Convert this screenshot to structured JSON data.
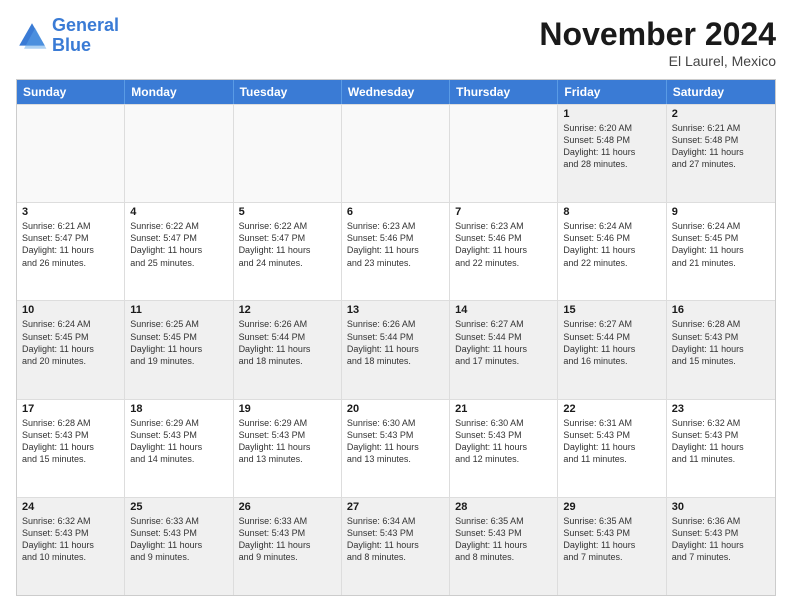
{
  "logo": {
    "line1": "General",
    "line2": "Blue"
  },
  "title": "November 2024",
  "location": "El Laurel, Mexico",
  "days": [
    "Sunday",
    "Monday",
    "Tuesday",
    "Wednesday",
    "Thursday",
    "Friday",
    "Saturday"
  ],
  "rows": [
    [
      {
        "day": "",
        "info": ""
      },
      {
        "day": "",
        "info": ""
      },
      {
        "day": "",
        "info": ""
      },
      {
        "day": "",
        "info": ""
      },
      {
        "day": "",
        "info": ""
      },
      {
        "day": "1",
        "info": "Sunrise: 6:20 AM\nSunset: 5:48 PM\nDaylight: 11 hours\nand 28 minutes."
      },
      {
        "day": "2",
        "info": "Sunrise: 6:21 AM\nSunset: 5:48 PM\nDaylight: 11 hours\nand 27 minutes."
      }
    ],
    [
      {
        "day": "3",
        "info": "Sunrise: 6:21 AM\nSunset: 5:47 PM\nDaylight: 11 hours\nand 26 minutes."
      },
      {
        "day": "4",
        "info": "Sunrise: 6:22 AM\nSunset: 5:47 PM\nDaylight: 11 hours\nand 25 minutes."
      },
      {
        "day": "5",
        "info": "Sunrise: 6:22 AM\nSunset: 5:47 PM\nDaylight: 11 hours\nand 24 minutes."
      },
      {
        "day": "6",
        "info": "Sunrise: 6:23 AM\nSunset: 5:46 PM\nDaylight: 11 hours\nand 23 minutes."
      },
      {
        "day": "7",
        "info": "Sunrise: 6:23 AM\nSunset: 5:46 PM\nDaylight: 11 hours\nand 22 minutes."
      },
      {
        "day": "8",
        "info": "Sunrise: 6:24 AM\nSunset: 5:46 PM\nDaylight: 11 hours\nand 22 minutes."
      },
      {
        "day": "9",
        "info": "Sunrise: 6:24 AM\nSunset: 5:45 PM\nDaylight: 11 hours\nand 21 minutes."
      }
    ],
    [
      {
        "day": "10",
        "info": "Sunrise: 6:24 AM\nSunset: 5:45 PM\nDaylight: 11 hours\nand 20 minutes."
      },
      {
        "day": "11",
        "info": "Sunrise: 6:25 AM\nSunset: 5:45 PM\nDaylight: 11 hours\nand 19 minutes."
      },
      {
        "day": "12",
        "info": "Sunrise: 6:26 AM\nSunset: 5:44 PM\nDaylight: 11 hours\nand 18 minutes."
      },
      {
        "day": "13",
        "info": "Sunrise: 6:26 AM\nSunset: 5:44 PM\nDaylight: 11 hours\nand 18 minutes."
      },
      {
        "day": "14",
        "info": "Sunrise: 6:27 AM\nSunset: 5:44 PM\nDaylight: 11 hours\nand 17 minutes."
      },
      {
        "day": "15",
        "info": "Sunrise: 6:27 AM\nSunset: 5:44 PM\nDaylight: 11 hours\nand 16 minutes."
      },
      {
        "day": "16",
        "info": "Sunrise: 6:28 AM\nSunset: 5:43 PM\nDaylight: 11 hours\nand 15 minutes."
      }
    ],
    [
      {
        "day": "17",
        "info": "Sunrise: 6:28 AM\nSunset: 5:43 PM\nDaylight: 11 hours\nand 15 minutes."
      },
      {
        "day": "18",
        "info": "Sunrise: 6:29 AM\nSunset: 5:43 PM\nDaylight: 11 hours\nand 14 minutes."
      },
      {
        "day": "19",
        "info": "Sunrise: 6:29 AM\nSunset: 5:43 PM\nDaylight: 11 hours\nand 13 minutes."
      },
      {
        "day": "20",
        "info": "Sunrise: 6:30 AM\nSunset: 5:43 PM\nDaylight: 11 hours\nand 13 minutes."
      },
      {
        "day": "21",
        "info": "Sunrise: 6:30 AM\nSunset: 5:43 PM\nDaylight: 11 hours\nand 12 minutes."
      },
      {
        "day": "22",
        "info": "Sunrise: 6:31 AM\nSunset: 5:43 PM\nDaylight: 11 hours\nand 11 minutes."
      },
      {
        "day": "23",
        "info": "Sunrise: 6:32 AM\nSunset: 5:43 PM\nDaylight: 11 hours\nand 11 minutes."
      }
    ],
    [
      {
        "day": "24",
        "info": "Sunrise: 6:32 AM\nSunset: 5:43 PM\nDaylight: 11 hours\nand 10 minutes."
      },
      {
        "day": "25",
        "info": "Sunrise: 6:33 AM\nSunset: 5:43 PM\nDaylight: 11 hours\nand 9 minutes."
      },
      {
        "day": "26",
        "info": "Sunrise: 6:33 AM\nSunset: 5:43 PM\nDaylight: 11 hours\nand 9 minutes."
      },
      {
        "day": "27",
        "info": "Sunrise: 6:34 AM\nSunset: 5:43 PM\nDaylight: 11 hours\nand 8 minutes."
      },
      {
        "day": "28",
        "info": "Sunrise: 6:35 AM\nSunset: 5:43 PM\nDaylight: 11 hours\nand 8 minutes."
      },
      {
        "day": "29",
        "info": "Sunrise: 6:35 AM\nSunset: 5:43 PM\nDaylight: 11 hours\nand 7 minutes."
      },
      {
        "day": "30",
        "info": "Sunrise: 6:36 AM\nSunset: 5:43 PM\nDaylight: 11 hours\nand 7 minutes."
      }
    ]
  ]
}
